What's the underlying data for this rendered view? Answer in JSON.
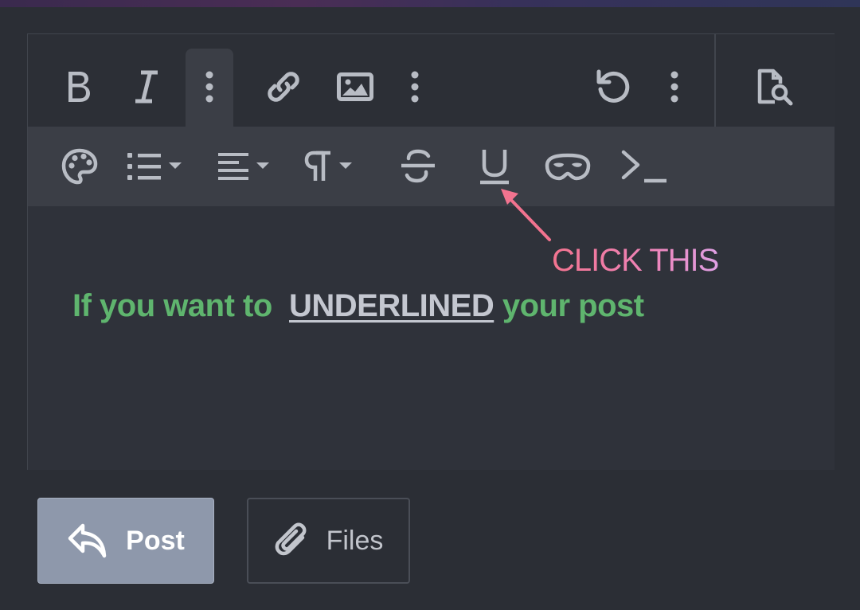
{
  "toolbar": {
    "main": [
      "bold-icon",
      "italic-icon",
      "more-vertical-icon",
      "link-icon",
      "image-icon",
      "more-vertical-icon",
      "undo-icon",
      "more-vertical-icon",
      "preview-icon"
    ],
    "sub": [
      "palette-icon",
      "list-icon",
      "align-icon",
      "paragraph-icon",
      "strikethrough-icon",
      "underline-icon",
      "spoiler-mask-icon",
      "code-terminal-icon"
    ]
  },
  "annotation": {
    "text": "CLICK THIS",
    "color": "#f2738f"
  },
  "content": {
    "prefix": "If you want to",
    "underlined": "UNDERLINED",
    "suffix": "your post",
    "green_color": "#5fb56e"
  },
  "buttons": {
    "post_label": "Post",
    "files_label": "Files"
  }
}
